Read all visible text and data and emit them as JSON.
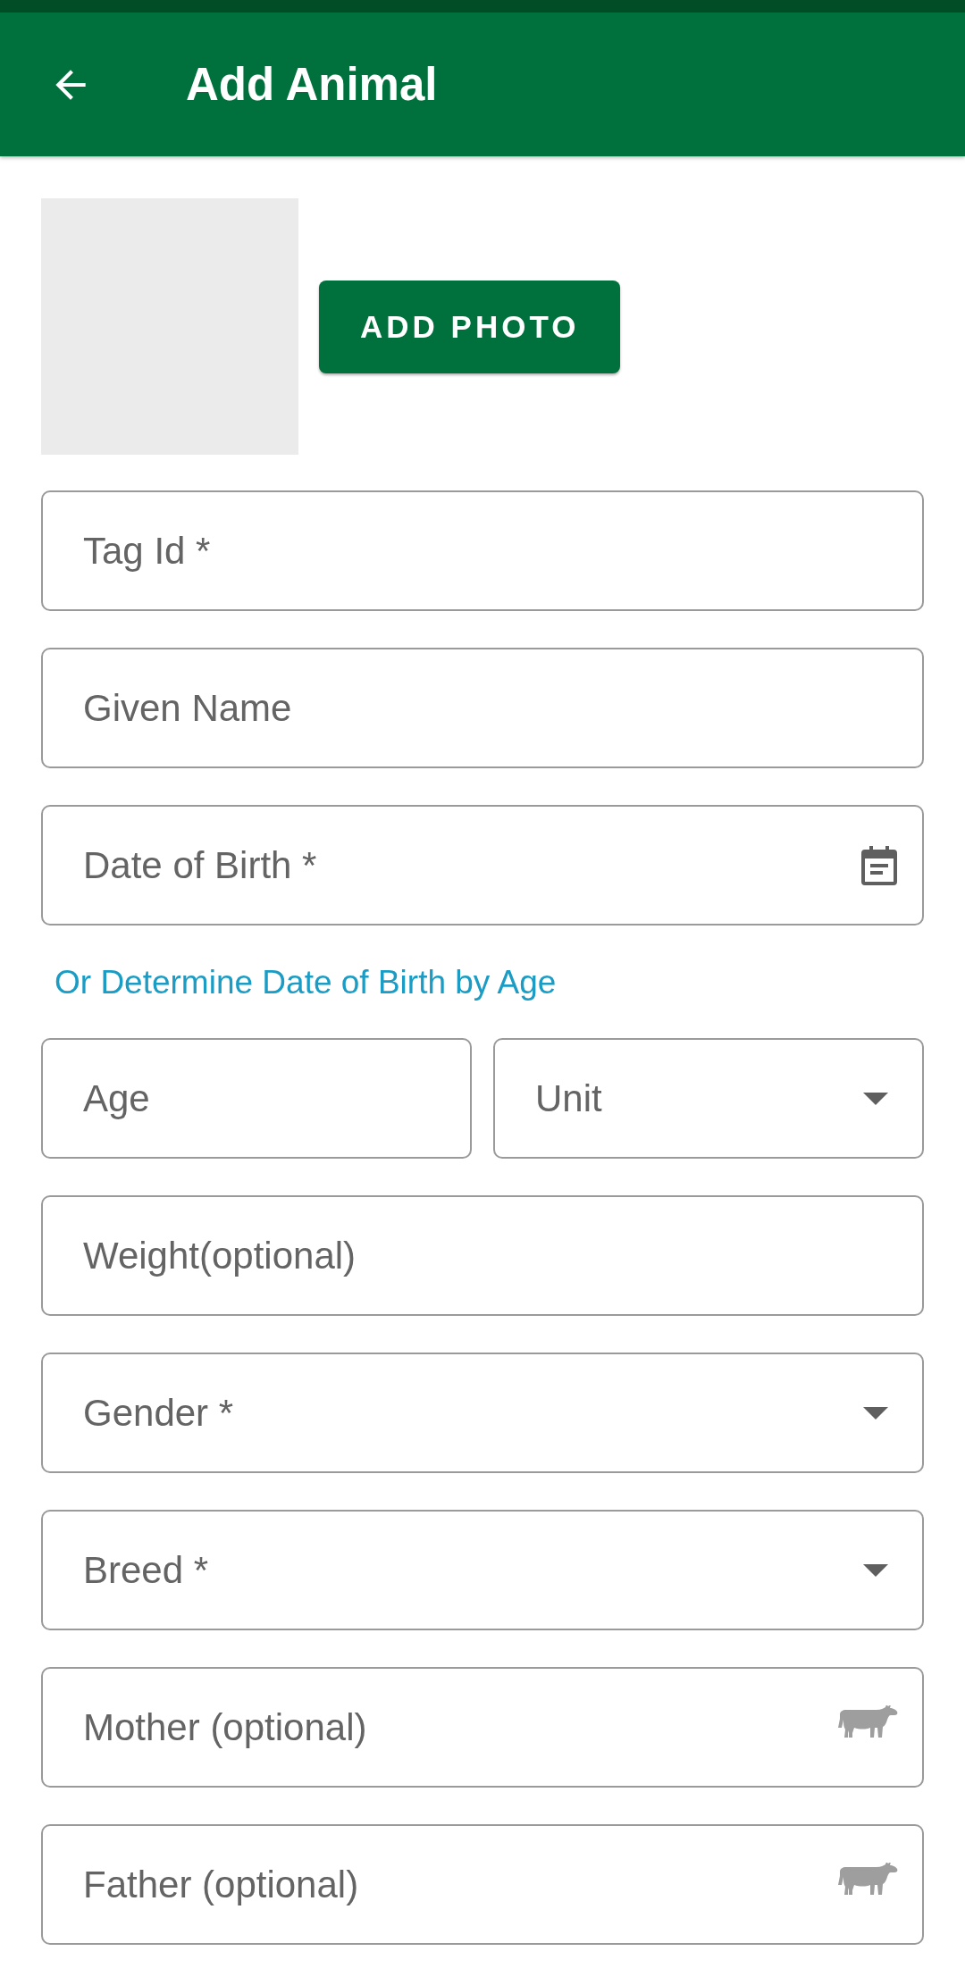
{
  "app_bar": {
    "title": "Add Animal"
  },
  "photo": {
    "button": "ADD PHOTO"
  },
  "form": [
    {
      "kind": "text",
      "placeholder": "Tag Id *"
    },
    {
      "kind": "text",
      "placeholder": "Given Name"
    },
    {
      "kind": "date",
      "placeholder": "Date of Birth *"
    },
    {
      "kind": "link",
      "label": "Or Determine Date of Birth by Age"
    },
    {
      "kind": "pair",
      "items": [
        {
          "kind": "text",
          "placeholder": "Age"
        },
        {
          "kind": "dropdown",
          "placeholder": "Unit"
        }
      ]
    },
    {
      "kind": "text",
      "placeholder": "Weight(optional)"
    },
    {
      "kind": "dropdown",
      "placeholder": "Gender *"
    },
    {
      "kind": "dropdown",
      "placeholder": "Breed *"
    },
    {
      "kind": "lookup",
      "placeholder": "Mother (optional)"
    },
    {
      "kind": "lookup",
      "placeholder": "Father (optional)"
    }
  ]
}
